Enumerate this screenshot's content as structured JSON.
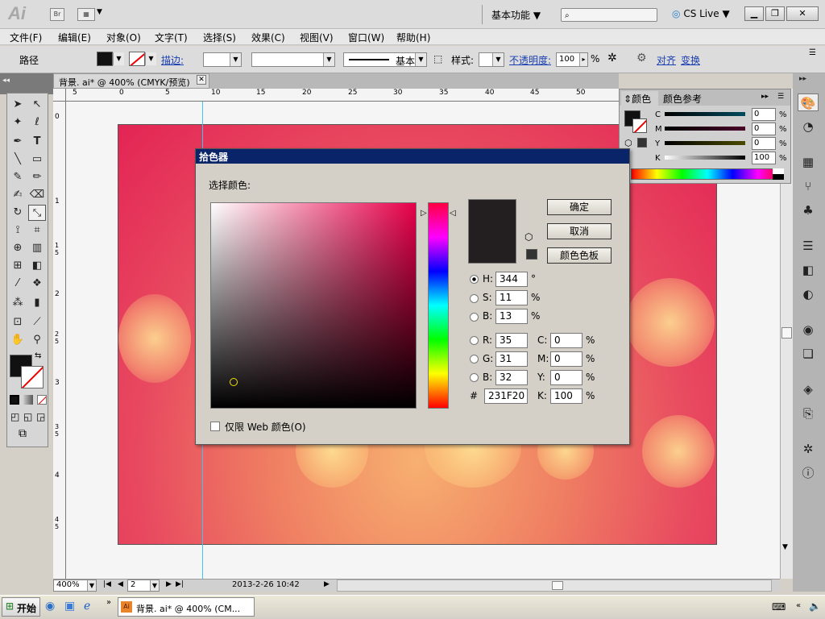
{
  "app": {
    "logo": "Ai",
    "bridge_label": "Br",
    "workspace": "基本功能",
    "cs_live": "CS Live"
  },
  "menu": [
    "文件(F)",
    "编辑(E)",
    "对象(O)",
    "文字(T)",
    "选择(S)",
    "效果(C)",
    "视图(V)",
    "窗口(W)",
    "帮助(H)"
  ],
  "control": {
    "path_label": "路径",
    "stroke_label": "描边:",
    "stroke_style": "基本",
    "style_label": "样式:",
    "opacity_label": "不透明度:",
    "opacity_value": "100",
    "opacity_unit": "%",
    "align_label": "对齐",
    "transform_label": "变换"
  },
  "document": {
    "tab_title": "背景. ai* @ 400% (CMYK/预览)",
    "ruler_h": [
      "5",
      "0",
      "5",
      "10",
      "15",
      "20",
      "25",
      "30",
      "35",
      "40",
      "45",
      "50"
    ],
    "ruler_v": [
      "0",
      "1",
      "1 5",
      "2",
      "2 5",
      "3",
      "3 5",
      "4",
      "4 5"
    ]
  },
  "status": {
    "zoom": "400%",
    "page": "2",
    "datetime": "2013-2-26  10:42"
  },
  "color_panel": {
    "tab_color": "颜色",
    "tab_guide": "颜色参考",
    "channels": [
      {
        "label": "C",
        "value": "0",
        "unit": "%"
      },
      {
        "label": "M",
        "value": "0",
        "unit": "%"
      },
      {
        "label": "Y",
        "value": "0",
        "unit": "%"
      },
      {
        "label": "K",
        "value": "100",
        "unit": "%"
      }
    ]
  },
  "picker": {
    "title": "拾色器",
    "select_label": "选择颜色:",
    "ok": "确定",
    "cancel": "取消",
    "swatches": "颜色色板",
    "web_only": "仅限 Web 颜色(O)",
    "current_color": "#231F20",
    "hsb": [
      {
        "label": "H:",
        "value": "344",
        "unit": "°"
      },
      {
        "label": "S:",
        "value": "11",
        "unit": "%"
      },
      {
        "label": "B:",
        "value": "13",
        "unit": "%"
      }
    ],
    "rgb": [
      {
        "label": "R:",
        "value": "35"
      },
      {
        "label": "G:",
        "value": "31"
      },
      {
        "label": "B:",
        "value": "32"
      }
    ],
    "hex_label": "#",
    "hex_value": "231F20",
    "cmyk": [
      {
        "label": "C:",
        "value": "0",
        "unit": "%"
      },
      {
        "label": "M:",
        "value": "0",
        "unit": "%"
      },
      {
        "label": "Y:",
        "value": "0",
        "unit": "%"
      },
      {
        "label": "K:",
        "value": "100",
        "unit": "%"
      }
    ]
  },
  "taskbar": {
    "start": "开始",
    "task_item": "背景. ai* @ 400% (CM..."
  },
  "icons": [
    "selection-tool-icon",
    "direct-selection-icon",
    "pen-icon",
    "type-icon",
    "hand-icon",
    "zoom-icon",
    "cube-icon",
    "info-icon"
  ]
}
